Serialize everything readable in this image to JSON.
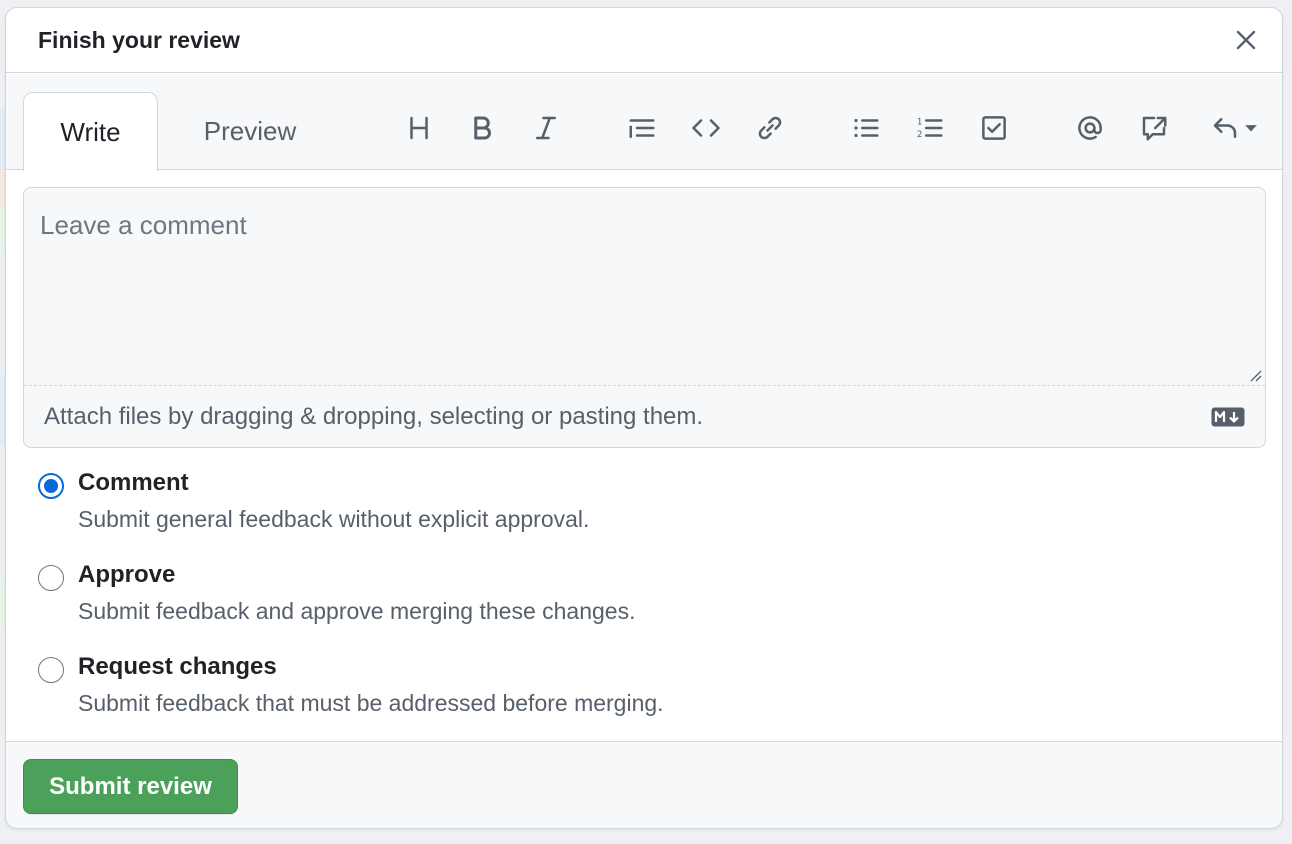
{
  "dialog": {
    "title": "Finish your review"
  },
  "tabs": {
    "write_label": "Write",
    "preview_label": "Preview"
  },
  "toolbar": {
    "icons": [
      "heading-icon",
      "bold-icon",
      "italic-icon",
      "quote-icon",
      "code-icon",
      "link-icon",
      "unordered-list-icon",
      "ordered-list-icon",
      "task-list-icon",
      "mention-icon",
      "cross-reference-icon",
      "reply-icon"
    ]
  },
  "editor": {
    "placeholder": "Leave a comment",
    "attach_hint": "Attach files by dragging & dropping, selecting or pasting them."
  },
  "options": [
    {
      "label": "Comment",
      "description": "Submit general feedback without explicit approval.",
      "checked": true
    },
    {
      "label": "Approve",
      "description": "Submit feedback and approve merging these changes.",
      "checked": false
    },
    {
      "label": "Request changes",
      "description": "Submit feedback that must be addressed before merging.",
      "checked": false
    }
  ],
  "footer": {
    "submit_label": "Submit review"
  },
  "colors": {
    "accent": "#0969da",
    "submit_bg": "#4ca15a",
    "border": "#d0d7de",
    "muted_bg": "#f6f8fa"
  }
}
